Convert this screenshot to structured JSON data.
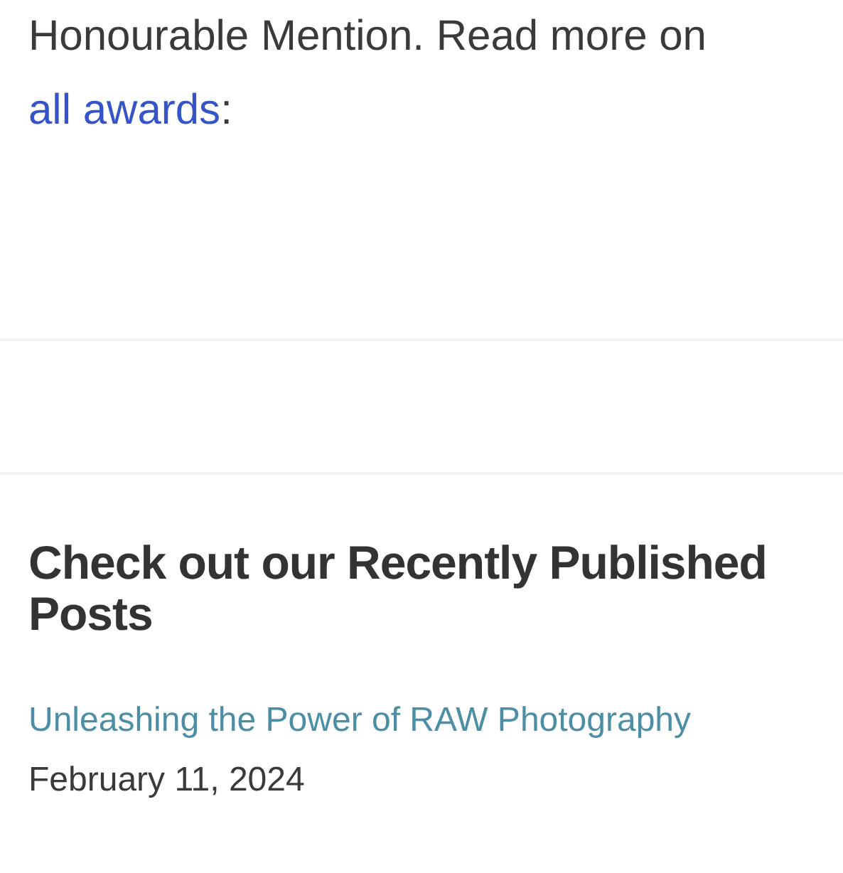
{
  "award_paragraph": {
    "text_before": "Honourable Mention. Read more on",
    "link": "all awards",
    "text_after": ":"
  },
  "recent_posts": {
    "heading": "Check out our Recently Published Posts",
    "posts": [
      {
        "title": "Unleashing the Power of RAW Photography",
        "date": "February 11, 2024"
      }
    ]
  }
}
